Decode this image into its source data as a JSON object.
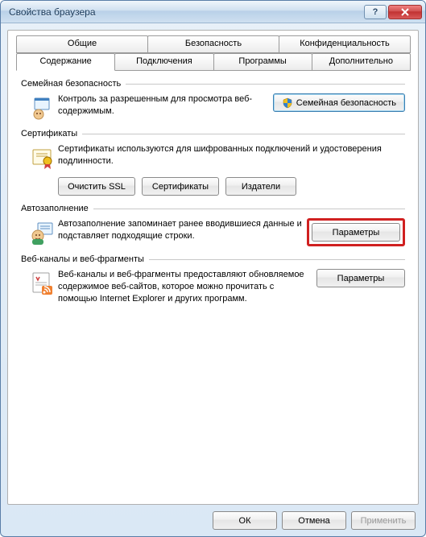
{
  "window": {
    "title": "Свойства браузера"
  },
  "tabs": {
    "row1": [
      "Общие",
      "Безопасность",
      "Конфиденциальность"
    ],
    "row2": [
      "Содержание",
      "Подключения",
      "Программы",
      "Дополнительно"
    ],
    "activeIndexRow2": 0
  },
  "groups": {
    "family": {
      "title": "Семейная безопасность",
      "desc": "Контроль за разрешенным для просмотра веб-содержимым.",
      "button": "Семейная безопасность"
    },
    "certs": {
      "title": "Сертификаты",
      "desc": "Сертификаты используются для шифрованных подключений и удостоверения подлинности.",
      "buttons": {
        "clearssl": "Очистить SSL",
        "certs": "Сертификаты",
        "publishers": "Издатели"
      }
    },
    "autofill": {
      "title": "Автозаполнение",
      "desc": "Автозаполнение запоминает ранее вводившиеся данные и подставляет подходящие строки.",
      "button": "Параметры"
    },
    "feeds": {
      "title": "Веб-каналы и веб-фрагменты",
      "desc": "Веб-каналы и веб-фрагменты предоставляют обновляемое содержимое веб-сайтов, которое можно прочитать с помощью Internet Explorer и других программ.",
      "button": "Параметры"
    }
  },
  "footer": {
    "ok": "ОК",
    "cancel": "Отмена",
    "apply": "Применить"
  }
}
